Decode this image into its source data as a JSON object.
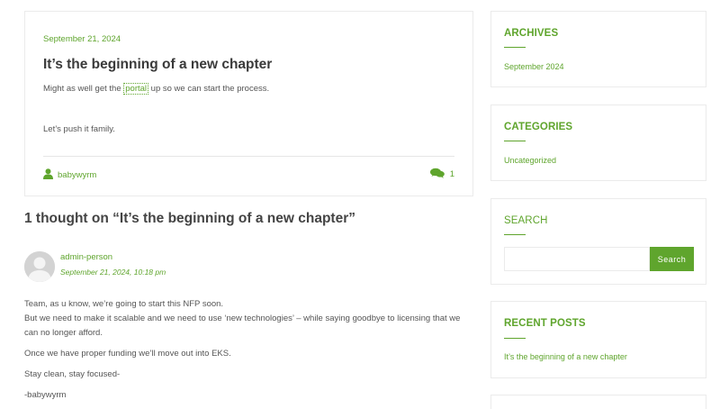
{
  "post": {
    "date": "September 21, 2024",
    "title": "It’s the beginning of a new chapter",
    "p1_before": "Might as well get the ",
    "p1_link": "portal",
    "p1_after": " up so we can start the process.",
    "p2": "Let’s push it family.",
    "author": "babywyrm",
    "comment_count": "1"
  },
  "comments": {
    "heading": "1 thought on “It’s the beginning of a new chapter”",
    "items": [
      {
        "author": "admin-person",
        "date": "September 21, 2024, 10:18 pm",
        "lines": [
          "Team, as u know, we’re going to start this NFP soon.",
          "But we need to make it scalable and we need to use ‘new technologies’ – while saying goodbye to licensing that we can no longer afford.",
          "Once we have proper funding we’ll move out into EKS.",
          "Stay clean, stay focused-",
          "-babywyrm"
        ]
      }
    ]
  },
  "sidebar": {
    "archives": {
      "title": "ARCHIVES",
      "items": [
        "September 2024"
      ]
    },
    "categories": {
      "title": "CATEGORIES",
      "items": [
        "Uncategorized"
      ]
    },
    "search": {
      "title": "SEARCH",
      "placeholder": "",
      "button": "Search"
    },
    "recent_posts": {
      "title": "RECENT POSTS",
      "items": [
        "It’s the beginning of a new chapter"
      ]
    }
  },
  "colors": {
    "accent": "#5fa52d",
    "text": "#555555",
    "border": "#ebebeb"
  }
}
